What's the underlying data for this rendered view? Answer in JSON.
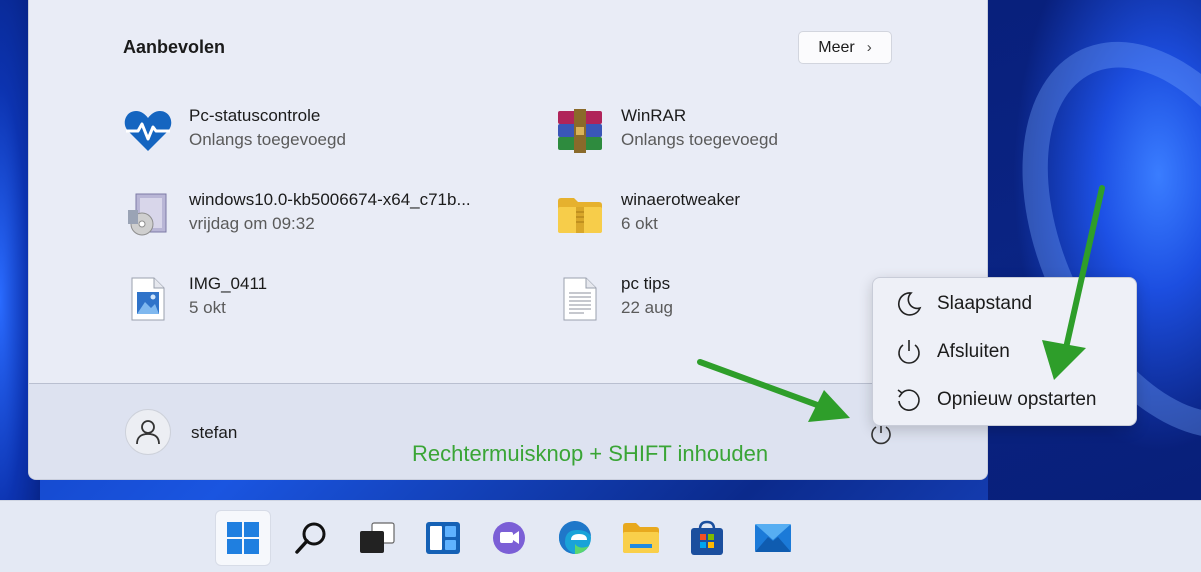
{
  "recommended": {
    "title": "Aanbevolen",
    "more_label": "Meer",
    "items": [
      {
        "name": "Pc-statuscontrole",
        "sub": "Onlangs toegevoegd",
        "icon": "health-heart-icon"
      },
      {
        "name": "WinRAR",
        "sub": "Onlangs toegevoegd",
        "icon": "winrar-books-icon"
      },
      {
        "name": "windows10.0-kb5006674-x64_c71b...",
        "sub": "vrijdag om 09:32",
        "icon": "installer-package-icon"
      },
      {
        "name": "winaerotweaker",
        "sub": "6 okt",
        "icon": "folder-zip-icon"
      },
      {
        "name": "IMG_0411",
        "sub": "5 okt",
        "icon": "image-file-icon"
      },
      {
        "name": "pc tips",
        "sub": "22 aug",
        "icon": "text-file-icon"
      }
    ]
  },
  "user": {
    "name": "stefan"
  },
  "annotation": "Rechtermuisknop + SHIFT inhouden",
  "power_menu": {
    "items": [
      {
        "label": "Slaapstand",
        "icon": "moon-icon"
      },
      {
        "label": "Afsluiten",
        "icon": "power-icon"
      },
      {
        "label": "Opnieuw opstarten",
        "icon": "restart-icon"
      }
    ]
  },
  "taskbar": {
    "apps": [
      "start-icon",
      "search-icon",
      "task-view-icon",
      "widgets-icon",
      "teams-chat-icon",
      "edge-icon",
      "file-explorer-icon",
      "store-icon",
      "mail-icon"
    ]
  },
  "colors": {
    "annotation": "#3aa536",
    "arrow": "#2e9e2a",
    "accent": "#0067c0"
  }
}
